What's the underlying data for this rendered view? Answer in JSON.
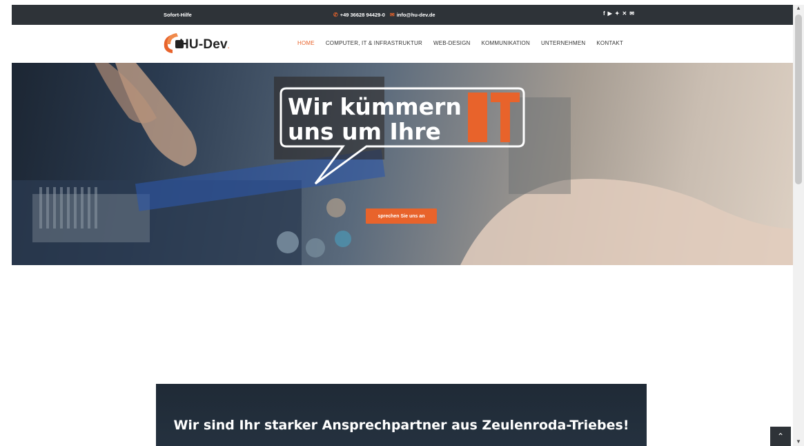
{
  "topbar": {
    "sofort": "Sofort-Hilfe",
    "phone": "+49 36628 94429-0",
    "email": "info@hu-dev.de",
    "phone_icon": "phone-icon",
    "mail_icon": "mail-icon",
    "social_icons": [
      "facebook-icon",
      "youtube-icon",
      "twitter-icon",
      "xing-icon",
      "mail-icon"
    ]
  },
  "brand": {
    "logo_text": "HU-Dev",
    "logo_dot": "."
  },
  "nav": {
    "items": [
      {
        "label": "HOME",
        "active": true
      },
      {
        "label": "COMPUTER, IT & INFRASTRUKTUR"
      },
      {
        "label": "WEB-DESIGN"
      },
      {
        "label": "KOMMUNIKATION"
      },
      {
        "label": "UNTERNEHMEN"
      },
      {
        "label": "KONTAKT"
      }
    ]
  },
  "hero": {
    "line1": "Wir kümmern",
    "line2": "uns um Ihre",
    "big": "IT",
    "button": "sprechen Sie uns an"
  },
  "section": {
    "heading": "Wir sind Ihr starker Ansprechpartner aus Zeulenroda-Triebes!"
  },
  "colors": {
    "accent": "#e8632b",
    "dark": "#2e3338"
  }
}
